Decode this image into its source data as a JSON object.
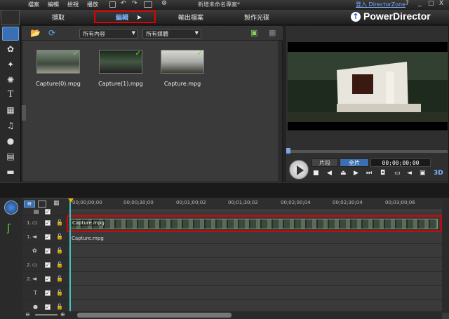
{
  "menu": {
    "file": "檔案",
    "edit": "編輯",
    "view": "檢視",
    "play": "播放"
  },
  "window": {
    "title": "新增未命名專案*",
    "login": "登入 DirectorZone",
    "help": "?",
    "minimize": "_",
    "maximize": "□",
    "close": "X"
  },
  "tabs": {
    "capture": "擷取",
    "edit": "編輯",
    "produce": "輸出檔案",
    "disc": "製作光碟"
  },
  "brand": {
    "name": "PowerDirector",
    "accent": "#3b6fb3"
  },
  "library": {
    "filter_content": "所有內容",
    "filter_media": "所有媒體",
    "items": [
      {
        "label": "Capture(0).mpg"
      },
      {
        "label": "Capture(1).mpg"
      },
      {
        "label": "Capture.mpg"
      }
    ]
  },
  "preview": {
    "clip_mode": "片段",
    "full_mode": "全片",
    "timecode": "00;00;00;00",
    "mode_3d": "3D"
  },
  "timeline": {
    "ruler": [
      "00;00;00;00",
      "00;00;30;00",
      "00;01;00;02",
      "00;01;30;02",
      "00;02;00;04",
      "00;02;30;04",
      "00;03;00;06"
    ],
    "tracks": [
      {
        "label": "1."
      },
      {
        "label": "1."
      },
      {
        "label": ""
      },
      {
        "label": "2."
      },
      {
        "label": "2."
      },
      {
        "label": ""
      },
      {
        "label": ""
      },
      {
        "label": ""
      }
    ],
    "video_clip": "Capture.mpg",
    "audio_clip": "Capture.mpg"
  }
}
